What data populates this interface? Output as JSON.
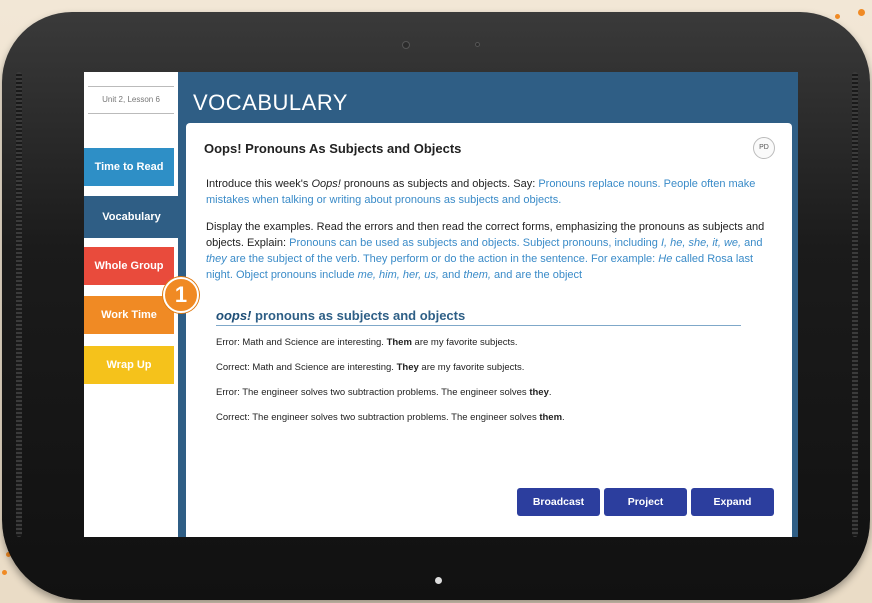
{
  "sidebar": {
    "lesson": "Unit 2, Lesson 6",
    "items": [
      {
        "label": "Time to Read",
        "color": "#2e8fc6"
      },
      {
        "label": "Vocabulary",
        "color": "#2f5e85"
      },
      {
        "label": "Whole Group",
        "color": "#e94b3c"
      },
      {
        "label": "Work Time",
        "color": "#f08a24"
      },
      {
        "label": "Wrap Up",
        "color": "#f5c21b"
      }
    ]
  },
  "header": {
    "title": "VOCABULARY"
  },
  "card": {
    "title": "Oops! Pronouns As Subjects and Objects",
    "badge": "PD",
    "p1": {
      "a": "Introduce this week's ",
      "b": "Oops!",
      "c": " pronouns as subjects and objects. Say: ",
      "d": "Pronouns replace nouns. People often make mistakes when talking or writing about pronouns as subjects and objects."
    },
    "p2": {
      "a": "Display the examples. Read the errors and then read the correct forms, emphasizing the pronouns as subjects and objects. Explain: ",
      "b": "Pronouns can be used as subjects and objects. Subject pronouns, including ",
      "c": "I, he, she, it, we,",
      "d": " and ",
      "e": "they",
      "f": " are the subject of the verb. They perform or do the action in the sentence. For example: ",
      "g": "He",
      "h": " called Rosa last night. Object pronouns include ",
      "i": "me, him, her, us,",
      "j": " and ",
      "k": "them,",
      "l": " and are the object"
    },
    "examples_title": {
      "italic": "oops!",
      "rest": " pronouns as subjects and objects"
    },
    "examples": [
      {
        "pre": "Error: Math and Science are interesting. ",
        "bold": "Them",
        "post": " are my favorite subjects."
      },
      {
        "pre": "Correct: Math and Science are interesting. ",
        "bold": "They",
        "post": " are my favorite subjects."
      },
      {
        "pre": "Error: The engineer solves two subtraction problems. The engineer solves ",
        "bold": "they",
        "post": "."
      },
      {
        "pre": "Correct: The engineer solves two subtraction problems. The engineer solves ",
        "bold": "them",
        "post": "."
      }
    ],
    "buttons": [
      "Broadcast",
      "Project",
      "Expand"
    ]
  },
  "callout": {
    "number": "1"
  }
}
